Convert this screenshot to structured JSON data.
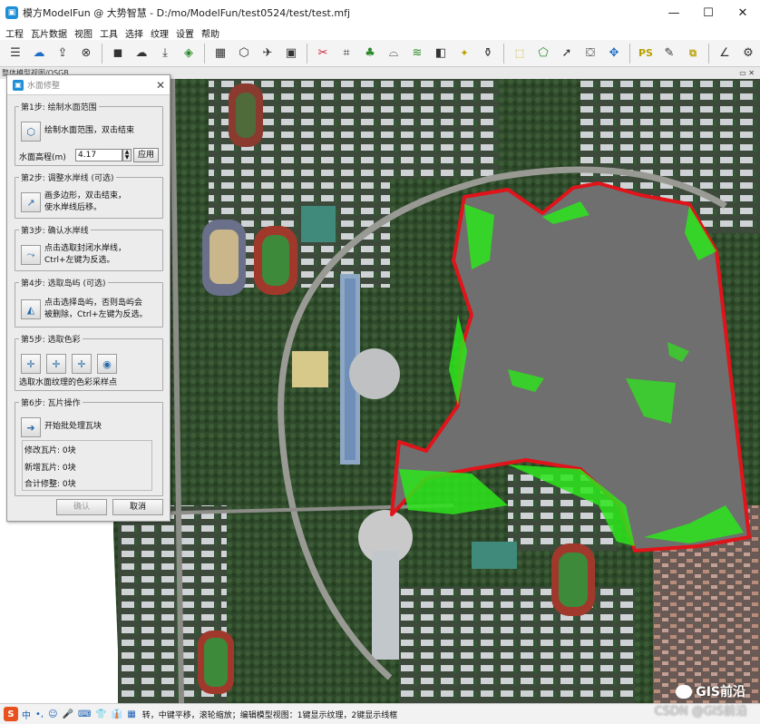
{
  "window": {
    "title": "模方ModelFun @ 大势智慧 - D:/mo/ModelFun/test0524/test/test.mfj",
    "app_icon": "app-logo-icon",
    "controls": [
      "—",
      "☐",
      "✕"
    ]
  },
  "menu": [
    "工程",
    "瓦片数据",
    "视图",
    "工具",
    "选择",
    "纹理",
    "设置",
    "帮助"
  ],
  "toolbar": {
    "icons": [
      "project-list-icon",
      "cloud-upload-icon",
      "export-icon",
      "close-circle-icon",
      "square-select-icon",
      "cloud-icon",
      "download-icon",
      "layers-icon",
      "grid-view-icon",
      "cube-icon",
      "plane-icon",
      "image-icon",
      "scissors-icon",
      "crop-icon",
      "tree-icon",
      "bridge-icon",
      "road-icon",
      "fill-icon",
      "wand-icon",
      "bucket-icon",
      "rect-select-icon",
      "polygon-select-icon",
      "pointer-icon",
      "basket-icon",
      "move-icon",
      "ps-icon",
      "brush-icon",
      "overlay-icon",
      "measure-icon",
      "settings-gear-icon"
    ],
    "ps_label": "PS"
  },
  "tabstrip": {
    "label": "整体模型视图/OSGB",
    "controls": "▭ ✕"
  },
  "panel": {
    "title": "水面修整",
    "close": "✕",
    "step1": {
      "legend": "第1步: 绘制水面范围",
      "button_text": "绘制水面范围，双击结束",
      "height_label": "水面高程(m)",
      "height_value": "4.17",
      "apply": "应用"
    },
    "step2": {
      "legend": "第2步: 调整水岸线 (可选)",
      "text_line1": "画多边形，双击结束，",
      "text_line2": "使水岸线后移。"
    },
    "step3": {
      "legend": "第3步: 确认水岸线",
      "text_line1": "点击选取封闭水岸线，",
      "text_line2": "Ctrl+左键为反选。"
    },
    "step4": {
      "legend": "第4步: 选取岛屿 (可选)",
      "text_line1": "点击选择岛屿，否则岛屿会",
      "text_line2": "被删除，Ctrl+左键为反选。"
    },
    "step5": {
      "legend": "第5步: 选取色彩",
      "hint": "选取水面纹理的色彩采样点"
    },
    "step6": {
      "legend": "第6步: 瓦片操作",
      "button_text": "开始批处理瓦块",
      "modified": "修改瓦片: 0块",
      "added": "新增瓦片: 0块",
      "total": "合计修整: 0块"
    },
    "confirm": "确认",
    "cancel": "取消"
  },
  "statusbar": {
    "ime_logo": "S",
    "ime_items": [
      "中",
      "•,",
      "☺",
      "🎤",
      "⌨",
      "👕",
      "👔",
      "▦"
    ],
    "text": "转，中键平移，滚轮缩放；编辑模型视图：1键显示纹理，2键显示线框"
  },
  "watermarks": {
    "primary": "GIS前沿",
    "secondary": "CSDN @GIS前沿"
  },
  "colors": {
    "water_outline": "#e0141a",
    "shoreline_marks": "#2de61c",
    "water_surface": "#6f6f6f",
    "app_accent": "#1d8fd8"
  }
}
